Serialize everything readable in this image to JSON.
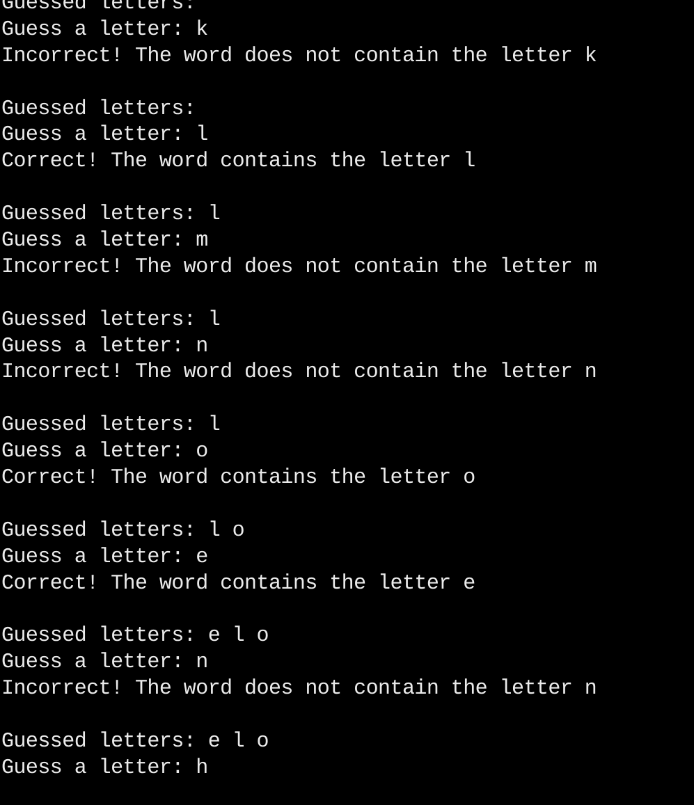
{
  "terminal": {
    "app": "console",
    "background_color": "#000000",
    "foreground_color": "#ebebeb",
    "font_size_px": 30,
    "line_height_px": 38,
    "columns_visible": 52,
    "lines": [
      "Guessed letters:",
      "Guess a letter: k",
      "Incorrect! The word does not contain the letter k",
      "",
      "Guessed letters:",
      "Guess a letter: l",
      "Correct! The word contains the letter l",
      "",
      "Guessed letters: l",
      "Guess a letter: m",
      "Incorrect! The word does not contain the letter m",
      "",
      "Guessed letters: l",
      "Guess a letter: n",
      "Incorrect! The word does not contain the letter n",
      "",
      "Guessed letters: l",
      "Guess a letter: o",
      "Correct! The word contains the letter o",
      "",
      "Guessed letters: l o",
      "Guess a letter: e",
      "Correct! The word contains the letter e",
      "",
      "Guessed letters: e l o",
      "Guess a letter: n",
      "Incorrect! The word does not contain the letter n",
      "",
      "Guessed letters: e l o",
      "Guess a letter: h"
    ],
    "game": {
      "name": "hangman",
      "prompt_label": "Guess a letter:",
      "guessed_label": "Guessed letters:",
      "correct_message": "Correct! The word contains the letter",
      "incorrect_message": "Incorrect! The word does not contain the letter",
      "rounds": [
        {
          "guessed_before": "",
          "guess": "k",
          "result": "incorrect"
        },
        {
          "guessed_before": "",
          "guess": "l",
          "result": "correct"
        },
        {
          "guessed_before": "l",
          "guess": "m",
          "result": "incorrect"
        },
        {
          "guessed_before": "l",
          "guess": "n",
          "result": "incorrect"
        },
        {
          "guessed_before": "l",
          "guess": "o",
          "result": "correct"
        },
        {
          "guessed_before": "l o",
          "guess": "e",
          "result": "correct"
        },
        {
          "guessed_before": "e l o",
          "guess": "n",
          "result": "incorrect"
        },
        {
          "guessed_before": "e l o",
          "guess": "h",
          "result": "pending"
        }
      ]
    }
  }
}
